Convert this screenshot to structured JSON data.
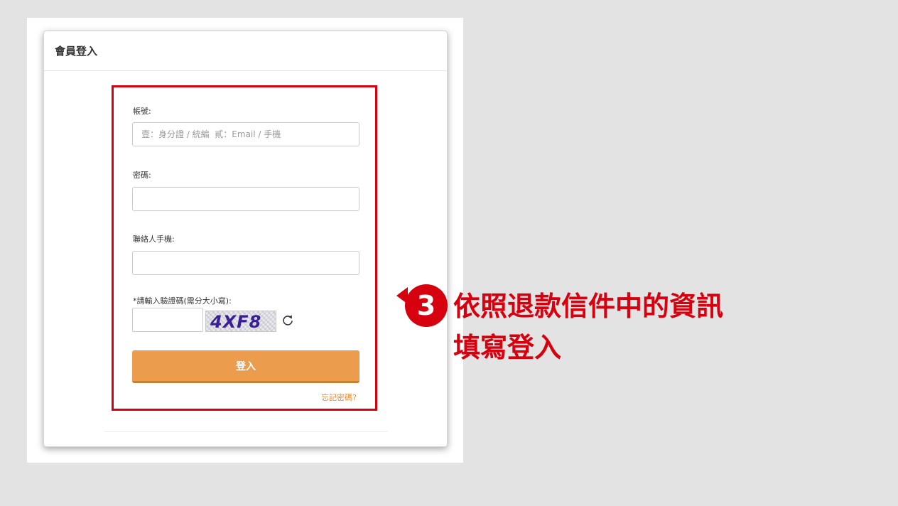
{
  "card": {
    "title": "會員登入"
  },
  "form": {
    "account_label": "帳號:",
    "account_placeholder": "壹：身分證 / 統編  貳：Email / 手機",
    "account_value": "",
    "password_label": "密碼:",
    "password_value": "",
    "phone_label": "聯絡人手機:",
    "phone_value": "",
    "captcha_label": "*請輸入驗證碼(需分大小寫):",
    "captcha_value": "",
    "captcha_image_text": "4XF8",
    "refresh_icon": "refresh-icon",
    "login_button": "登入",
    "forgot_password": "忘記密碼?"
  },
  "annotation": {
    "step_number": "3",
    "line1": "依照退款信件中的資訊",
    "line2": "填寫登入"
  },
  "colors": {
    "accent_red": "#d7000f",
    "button_orange": "#eb9c4c",
    "link_orange": "#e58a2f",
    "background": "#e3e3e3"
  }
}
